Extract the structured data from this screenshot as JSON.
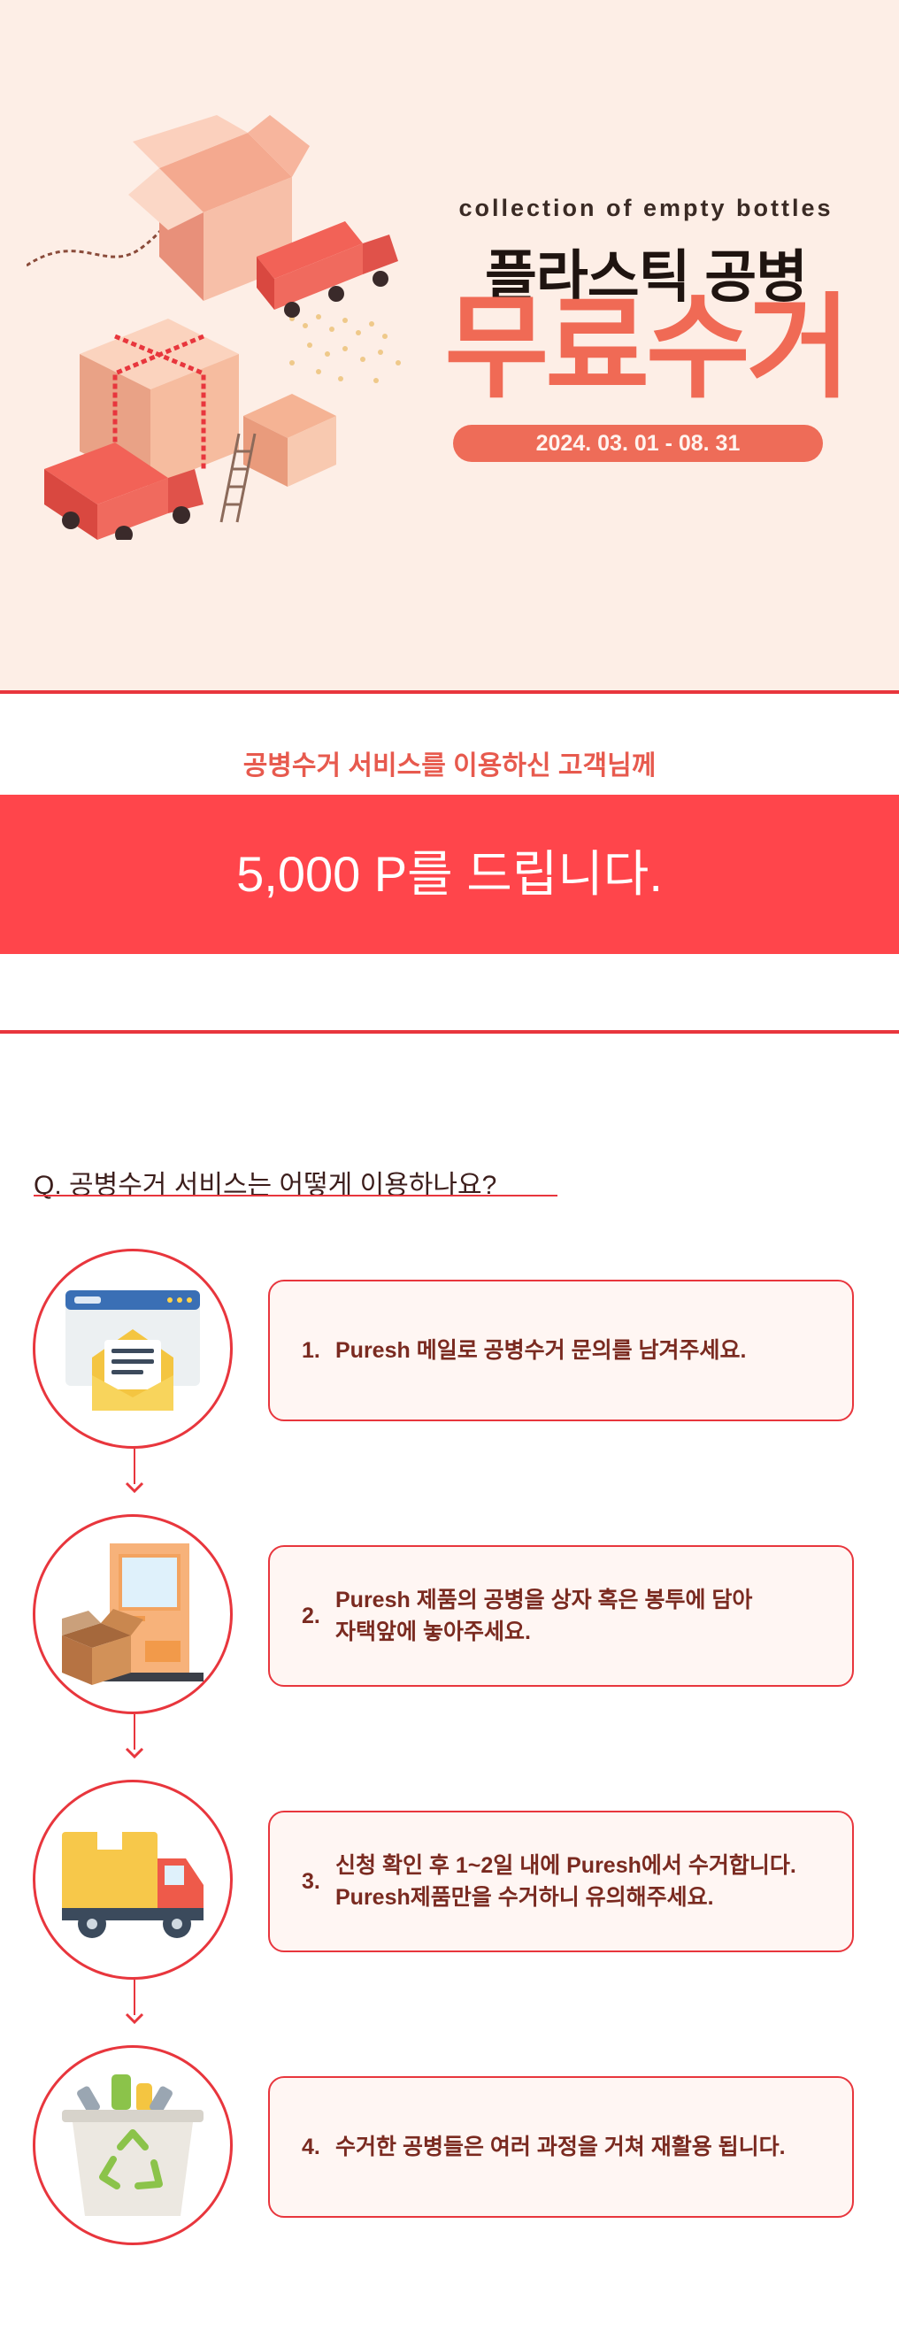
{
  "hero": {
    "subtitle_en": "collection of empty bottles",
    "title": "플라스틱 공병",
    "title_big": "무료수거",
    "date_range": "2024. 03. 01 - 08. 31"
  },
  "promo": {
    "subheading": "공병수거 서비스를 이용하신 고객님께",
    "points_text": "5,000 P를 드립니다."
  },
  "qa": {
    "question": "Q. 공병수거 서비스는 어떻게 이용하나요?"
  },
  "steps": [
    {
      "num": "1.",
      "icon": "mail-envelope-icon",
      "line1": "Puresh 메일로 공병수거 문의를 남겨주세요.",
      "line2": ""
    },
    {
      "num": "2.",
      "icon": "door-box-icon",
      "line1": "Puresh 제품의 공병을 상자 혹은 봉투에 담아",
      "line2": "자택앞에 놓아주세요."
    },
    {
      "num": "3.",
      "icon": "delivery-truck-icon",
      "line1": "신청 확인 후 1~2일 내에 Puresh에서 수거합니다.",
      "line2": "Puresh제품만을 수거하니 유의해주세요."
    },
    {
      "num": "4.",
      "icon": "recycle-bin-icon",
      "line1": "수거한 공병들은 여러 과정을 거쳐 재활용 됩니다.",
      "line2": ""
    }
  ],
  "colors": {
    "hero_bg": "#fdeee6",
    "accent_red": "#e8363d",
    "points_band": "#ff454b",
    "coral": "#f06a55",
    "step_text": "#7a2a20"
  }
}
